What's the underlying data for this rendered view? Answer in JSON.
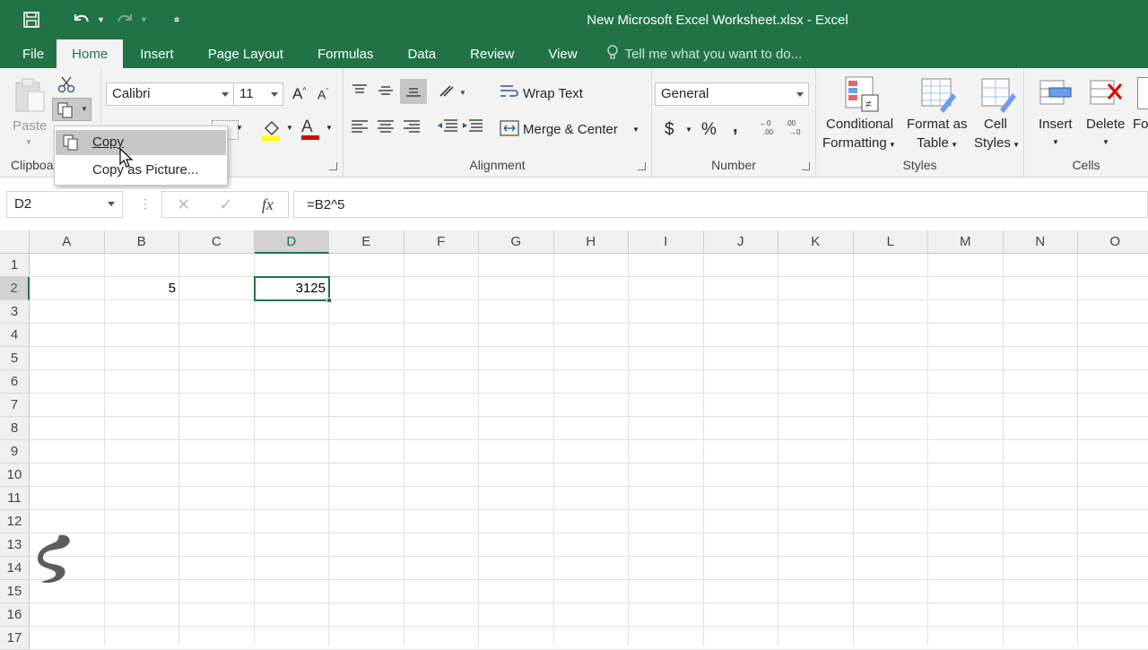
{
  "window": {
    "title": "New Microsoft Excel Worksheet.xlsx - Excel"
  },
  "qat": {
    "save_icon": "save-icon",
    "undo_icon": "undo-icon",
    "redo_icon": "redo-icon",
    "customize_icon": "customize-qat-icon"
  },
  "tabs": [
    {
      "label": "File"
    },
    {
      "label": "Home"
    },
    {
      "label": "Insert"
    },
    {
      "label": "Page Layout"
    },
    {
      "label": "Formulas"
    },
    {
      "label": "Data"
    },
    {
      "label": "Review"
    },
    {
      "label": "View"
    }
  ],
  "tellme": {
    "placeholder": "Tell me what you want to do..."
  },
  "ribbon": {
    "clipboard": {
      "label": "Clipboard",
      "paste": "Paste"
    },
    "font": {
      "name": "Calibri",
      "size": "11",
      "grow": "A",
      "shrink": "A",
      "font_color_letter": "A"
    },
    "alignment": {
      "label": "Alignment",
      "wrap": "Wrap Text",
      "merge": "Merge & Center"
    },
    "number": {
      "label": "Number",
      "format": "General",
      "currency": "$",
      "percent": "%",
      "comma": ","
    },
    "styles": {
      "label": "Styles",
      "conditional_1": "Conditional",
      "conditional_2": "Formatting",
      "table_1": "Format as",
      "table_2": "Table",
      "cell_1": "Cell",
      "cell_2": "Styles"
    },
    "cells": {
      "label": "Cells",
      "insert": "Insert",
      "delete": "Delete",
      "format": "Fo"
    }
  },
  "copy_menu": {
    "items": [
      {
        "label": "Copy",
        "highlighted": true
      },
      {
        "label": "Copy as Picture..."
      }
    ]
  },
  "formula_bar": {
    "name_box": "D2",
    "fx": "fx",
    "formula": "=B2^5"
  },
  "grid": {
    "columns": [
      "A",
      "B",
      "C",
      "D",
      "E",
      "F",
      "G",
      "H",
      "I",
      "J",
      "K",
      "L",
      "M",
      "N",
      "O"
    ],
    "rows": [
      "1",
      "2",
      "3",
      "4",
      "5",
      "6",
      "7",
      "8",
      "9",
      "10",
      "11",
      "12",
      "13",
      "14",
      "15",
      "16",
      "17"
    ],
    "selected_column": "D",
    "selected_row": "2",
    "cells": {
      "B2": "5",
      "D2": "3125"
    }
  }
}
